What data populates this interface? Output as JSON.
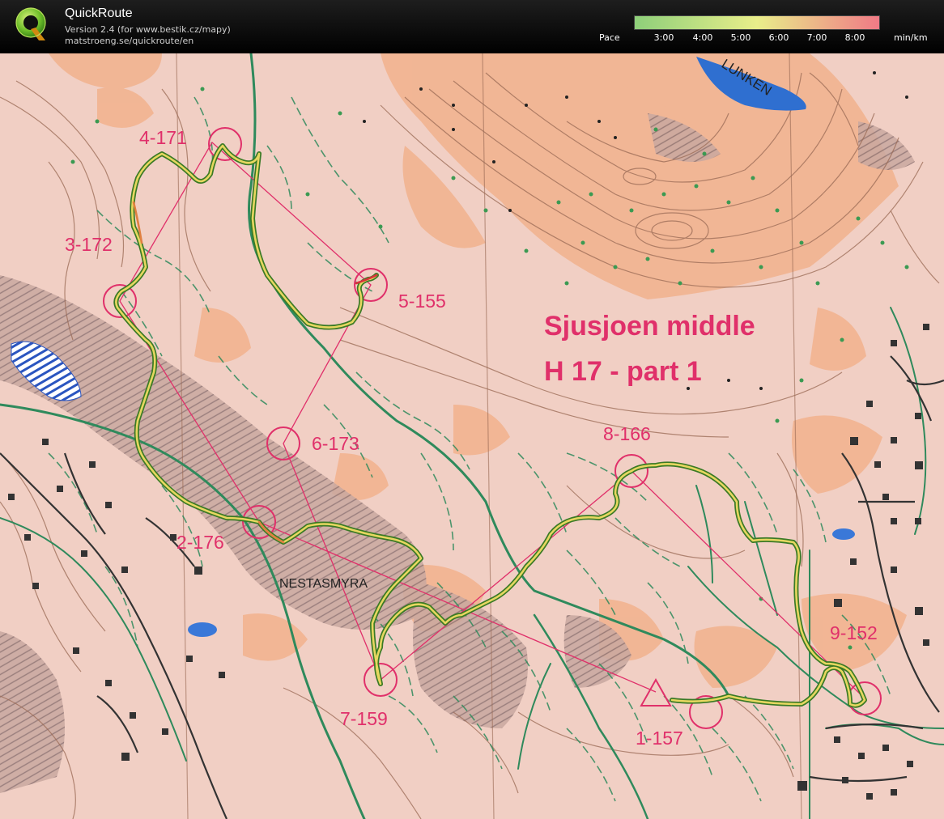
{
  "header": {
    "app_name": "QuickRoute",
    "version_text": "Version 2.4  (for www.bestik.cz/mapy)",
    "url_text": "matstroeng.se/quickroute/en",
    "logo_letter": "Q"
  },
  "pace_legend": {
    "label": "Pace",
    "unit": "min/km",
    "ticks": [
      "3:00",
      "4:00",
      "5:00",
      "6:00",
      "7:00",
      "8:00"
    ],
    "color_start": "#8ecf7a",
    "color_mid": "#e9ee8a",
    "color_end": "#f07a86"
  },
  "map": {
    "title_line1": "Sjusjoen middle",
    "title_line2": "H 17 - part 1",
    "place_names": [
      "LUNKEN",
      "NESTASMYRA"
    ],
    "controls": [
      "4-171",
      "3-172",
      "5-155",
      "6-173",
      "2-176",
      "8-166",
      "7-159",
      "9-152",
      "1-157"
    ],
    "colors": {
      "paper": "#f1cfc4",
      "open_land": "#f2ae86",
      "contour": "#9a6a55",
      "water": "#2f6fd0",
      "marsh": "#6a86c8",
      "course": "#e0306a",
      "track": "#2f8a5c",
      "route_outer": "#3a7a25",
      "route_inner": "#e6d760",
      "building": "#333333"
    }
  }
}
